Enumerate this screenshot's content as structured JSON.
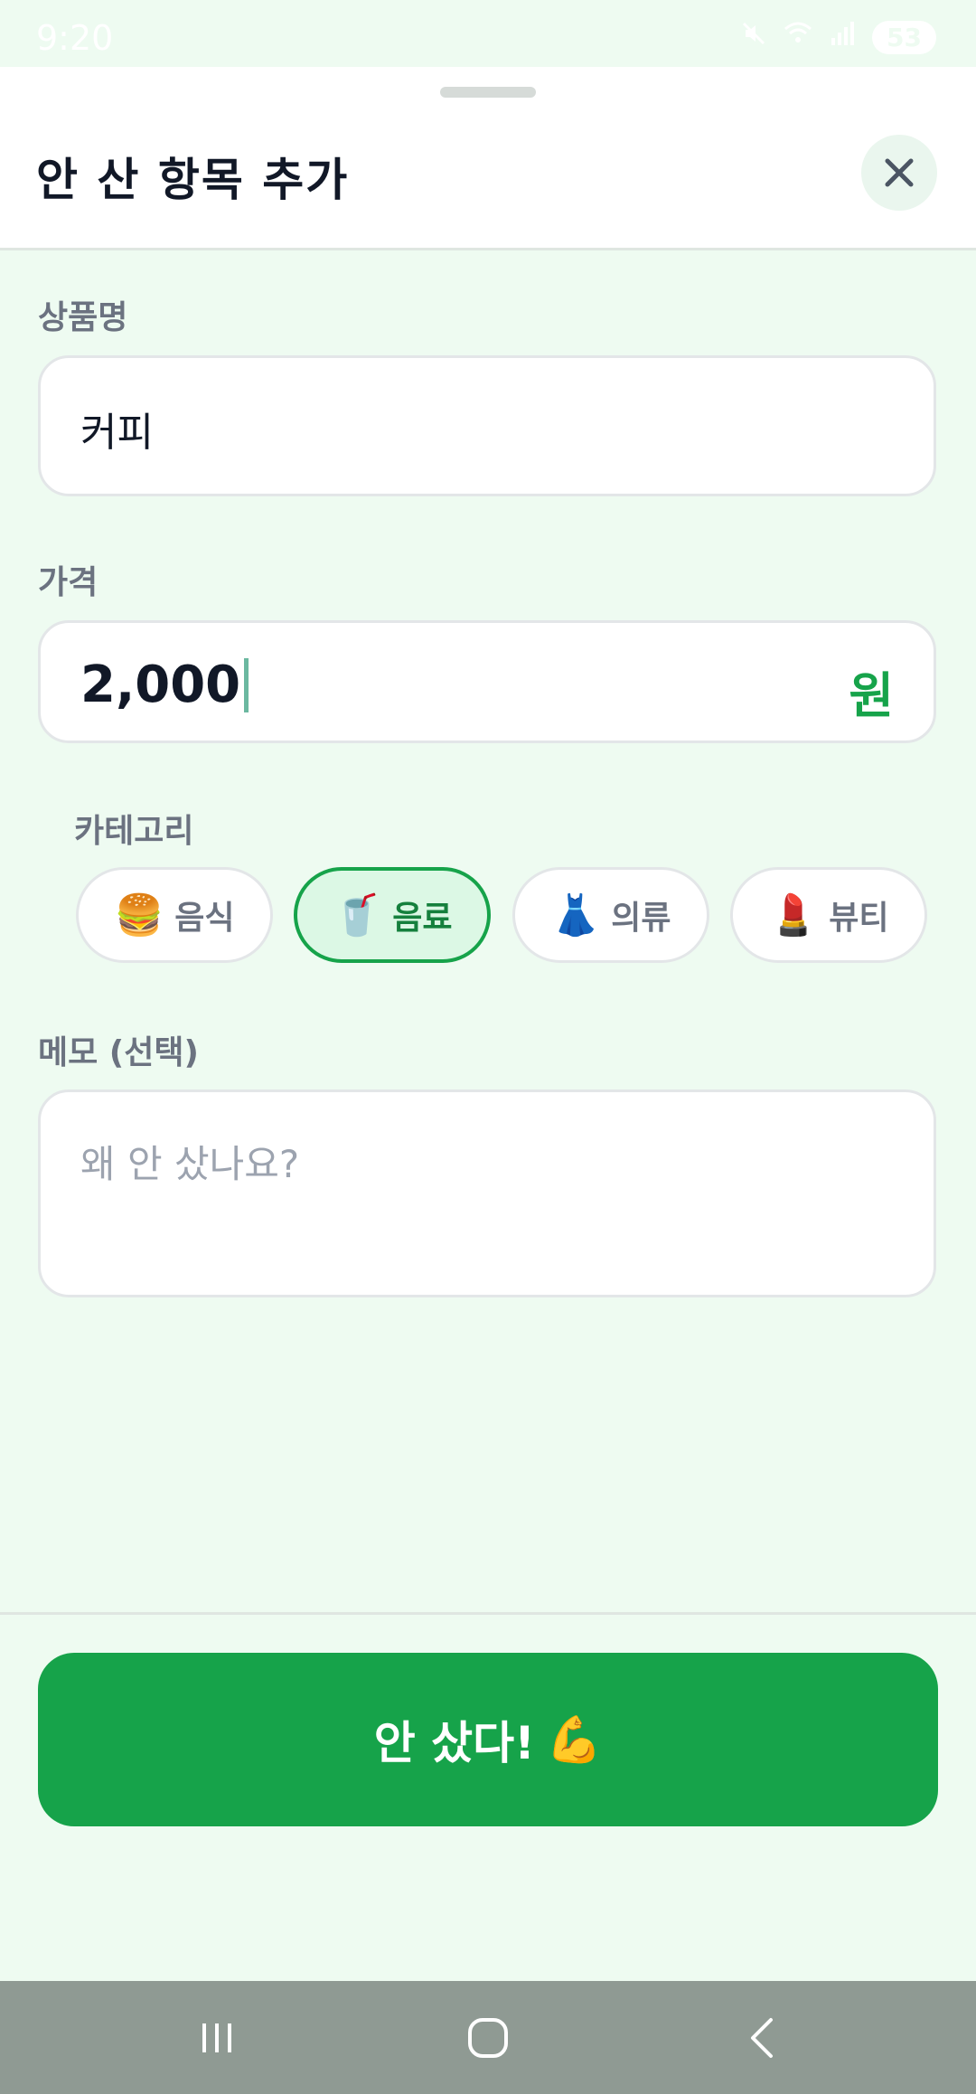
{
  "status_bar": {
    "time": "9:20",
    "battery": "53",
    "icons": [
      "location-icon",
      "mute-icon",
      "wifi-icon",
      "signal-icon",
      "battery-icon"
    ]
  },
  "sheet": {
    "title": "안 산 항목 추가",
    "close_icon": "close-icon"
  },
  "form": {
    "name": {
      "label": "상품명",
      "value": "커피"
    },
    "price": {
      "label": "가격",
      "value": "2,000",
      "unit": "원"
    },
    "category": {
      "label": "카테고리",
      "selected": "음료",
      "options": [
        {
          "emoji": "🍔",
          "label": "음식",
          "icon": "hamburger-icon"
        },
        {
          "emoji": "🥤",
          "label": "음료",
          "icon": "drink-cup-icon"
        },
        {
          "emoji": "👗",
          "label": "의류",
          "icon": "dress-icon"
        },
        {
          "emoji": "💄",
          "label": "뷰티",
          "icon": "lipstick-icon"
        }
      ]
    },
    "memo": {
      "label": "메모 (선택)",
      "placeholder": "왜 안 샀나요?"
    }
  },
  "submit": {
    "label": "안 샀다!",
    "emoji": "💪"
  },
  "colors": {
    "accent": "#16a34a",
    "background": "#eefbf1",
    "chip_selected_bg": "#dcf8e5",
    "nav_bar": "#8f9a93"
  },
  "nav": {
    "items": [
      "recent-apps-icon",
      "home-icon",
      "back-icon"
    ]
  }
}
